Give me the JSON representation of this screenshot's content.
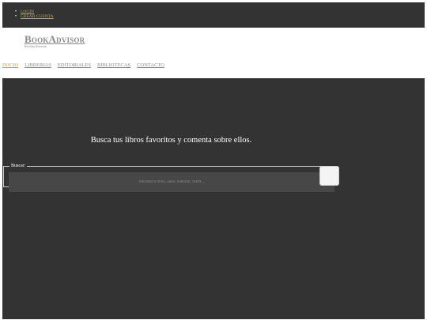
{
  "topbar": {
    "links": [
      {
        "label": "LOGIN"
      },
      {
        "label": "CREAR CUENTA"
      }
    ]
  },
  "brand": {
    "name": "BookAdvisor",
    "tagline": "Reseñas literarias"
  },
  "nav": {
    "items": [
      {
        "label": "INICIO",
        "active": true
      },
      {
        "label": "LIBRERIAS",
        "active": false
      },
      {
        "label": "EDITORIALES",
        "active": false
      },
      {
        "label": "BIBLIOTECAS",
        "active": false
      },
      {
        "label": "CONTACTO",
        "active": false
      }
    ]
  },
  "hero": {
    "title": "Busca tus libros favoritos y comenta sobre ellos."
  },
  "search": {
    "legend": "Buscar:",
    "placeholder": "Introduzca título, autor, editorial, ISBN...",
    "value": ""
  },
  "colors": {
    "dark_bg": "#333333",
    "accent_link": "#c8a24a",
    "muted_link": "#8a8a8a",
    "input_bg": "#474747"
  }
}
